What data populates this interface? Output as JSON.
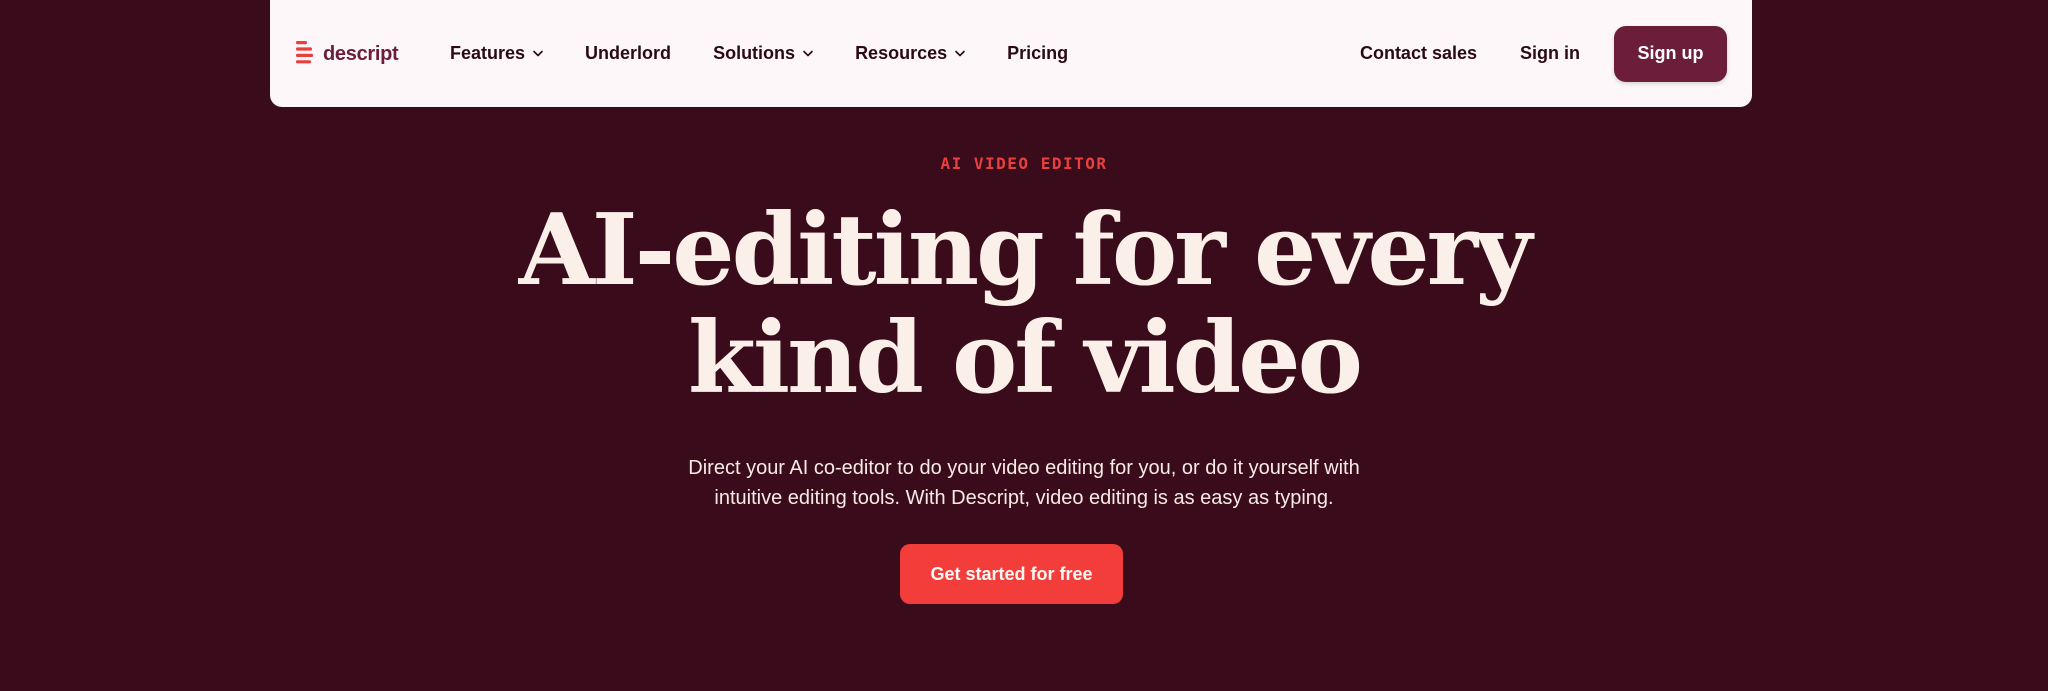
{
  "colors": {
    "page_background": "#3a0b1b",
    "nav_background": "#fdf7f9",
    "brand": "#6b1d3a",
    "accent": "#f23d3b",
    "eyebrow": "#e8403e",
    "headline": "#fbefe9"
  },
  "nav": {
    "logo": {
      "icon": "descript-logo-icon",
      "text": "descript"
    },
    "items": [
      {
        "label": "Features",
        "has_dropdown": true,
        "icon": "chevron-down-icon"
      },
      {
        "label": "Underlord",
        "has_dropdown": false
      },
      {
        "label": "Solutions",
        "has_dropdown": true,
        "icon": "chevron-down-icon"
      },
      {
        "label": "Resources",
        "has_dropdown": true,
        "icon": "chevron-down-icon"
      },
      {
        "label": "Pricing",
        "has_dropdown": false
      }
    ],
    "contact_label": "Contact sales",
    "signin_label": "Sign in",
    "signup_label": "Sign up"
  },
  "hero": {
    "eyebrow": "AI VIDEO EDITOR",
    "headline_line1": "AI-editing for every",
    "headline_line2": "kind of video",
    "subcopy_line1": "Direct your AI co-editor to do your video editing for you, or do it yourself with",
    "subcopy_line2": "intuitive editing tools. With Descript, video editing is as easy as typing.",
    "cta_label": "Get started for free"
  }
}
